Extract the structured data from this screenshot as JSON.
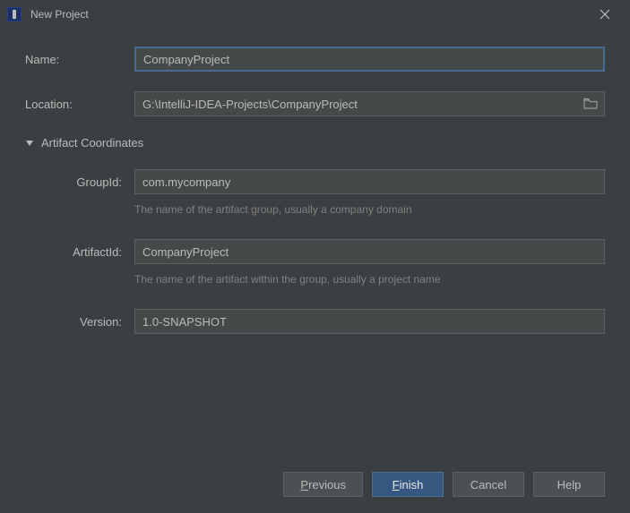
{
  "title": "New Project",
  "fields": {
    "name_label": "Name:",
    "name_value": "CompanyProject",
    "location_label": "Location:",
    "location_value": "G:\\IntelliJ-IDEA-Projects\\CompanyProject"
  },
  "artifact": {
    "section_title": "Artifact Coordinates",
    "groupid_label": "GroupId:",
    "groupid_value": "com.mycompany",
    "groupid_hint": "The name of the artifact group, usually a company domain",
    "artifactid_label": "ArtifactId:",
    "artifactid_value": "CompanyProject",
    "artifactid_hint": "The name of the artifact within the group, usually a project name",
    "version_label": "Version:",
    "version_value": "1.0-SNAPSHOT"
  },
  "buttons": {
    "previous_prefix": "P",
    "previous_rest": "revious",
    "finish_prefix": "F",
    "finish_rest": "inish",
    "cancel": "Cancel",
    "help": "Help"
  }
}
